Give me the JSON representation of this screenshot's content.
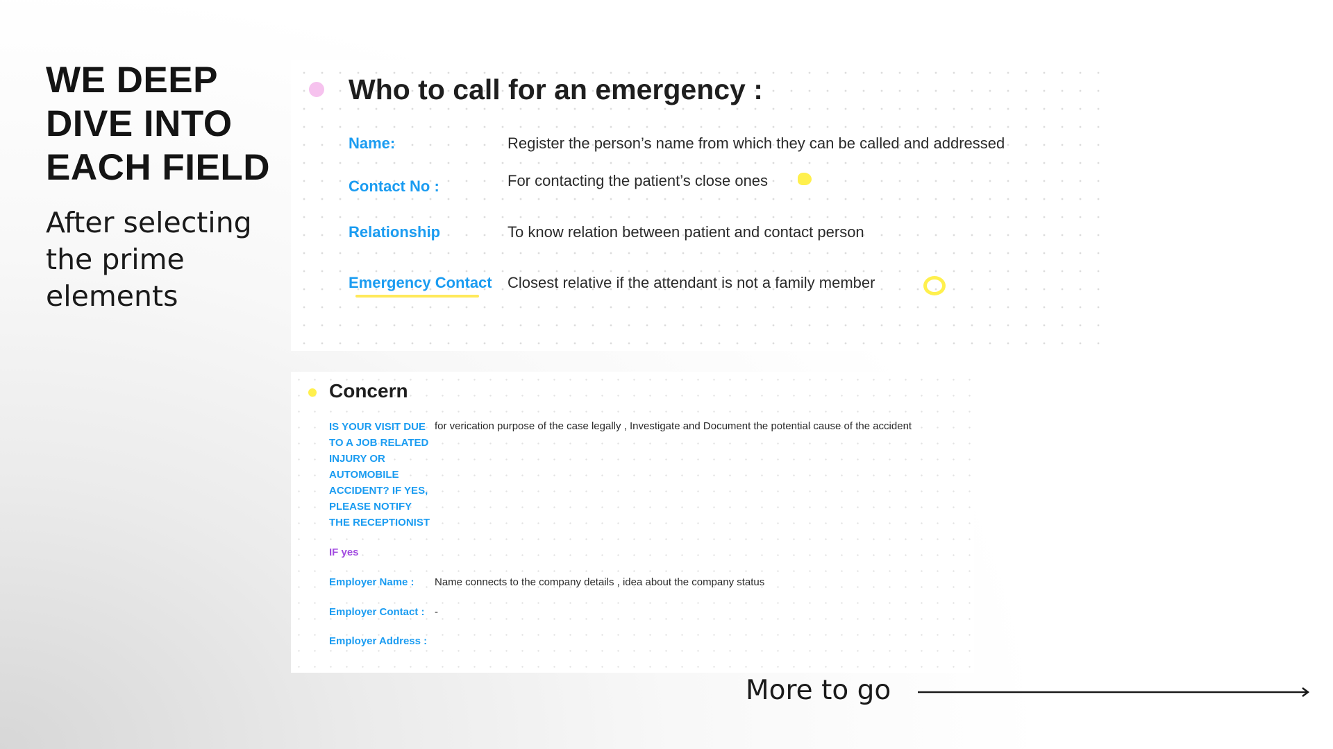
{
  "heading": {
    "line1": "WE DEEP",
    "line2": "DIVE INTO",
    "line3": "EACH FIELD"
  },
  "subheading": {
    "line1": "After selecting",
    "line2": "the prime",
    "line3": "elements"
  },
  "emergency": {
    "title": "Who to call for an emergency :",
    "fields": [
      {
        "label": "Name:",
        "description": "Register the person’s name from which they can be called and addressed"
      },
      {
        "label": "Contact No :",
        "description": "For contacting the patient’s close ones"
      },
      {
        "label": "Relationship",
        "description": "To know relation between patient and contact person"
      },
      {
        "label": "Emergency Contact",
        "description": "Closest relative if the attendant is not a family member"
      }
    ]
  },
  "concern": {
    "title": "Concern",
    "question": "IS YOUR VISIT DUE TO A JOB RELATED INJURY OR AUTOMOBILE ACCIDENT? IF YES, PLEASE NOTIFY THE RECEPTIONIST",
    "question_description": "for verication purpose of the case legally , Investigate and Document the potential cause of the accident",
    "if_yes_label": "IF yes",
    "fields": [
      {
        "label": "Employer Name :",
        "description": "Name connects to the company details , idea about the company status"
      },
      {
        "label": "Employer Contact :",
        "description": "-"
      },
      {
        "label": "Employer Address :",
        "description": ""
      }
    ]
  },
  "footer": {
    "more_label": "More to go"
  },
  "colors": {
    "label_blue": "#1b9cf1",
    "if_yes_purple": "#a24be0",
    "highlight_yellow": "#fff04d",
    "bullet_pink": "#f6c2ee"
  }
}
